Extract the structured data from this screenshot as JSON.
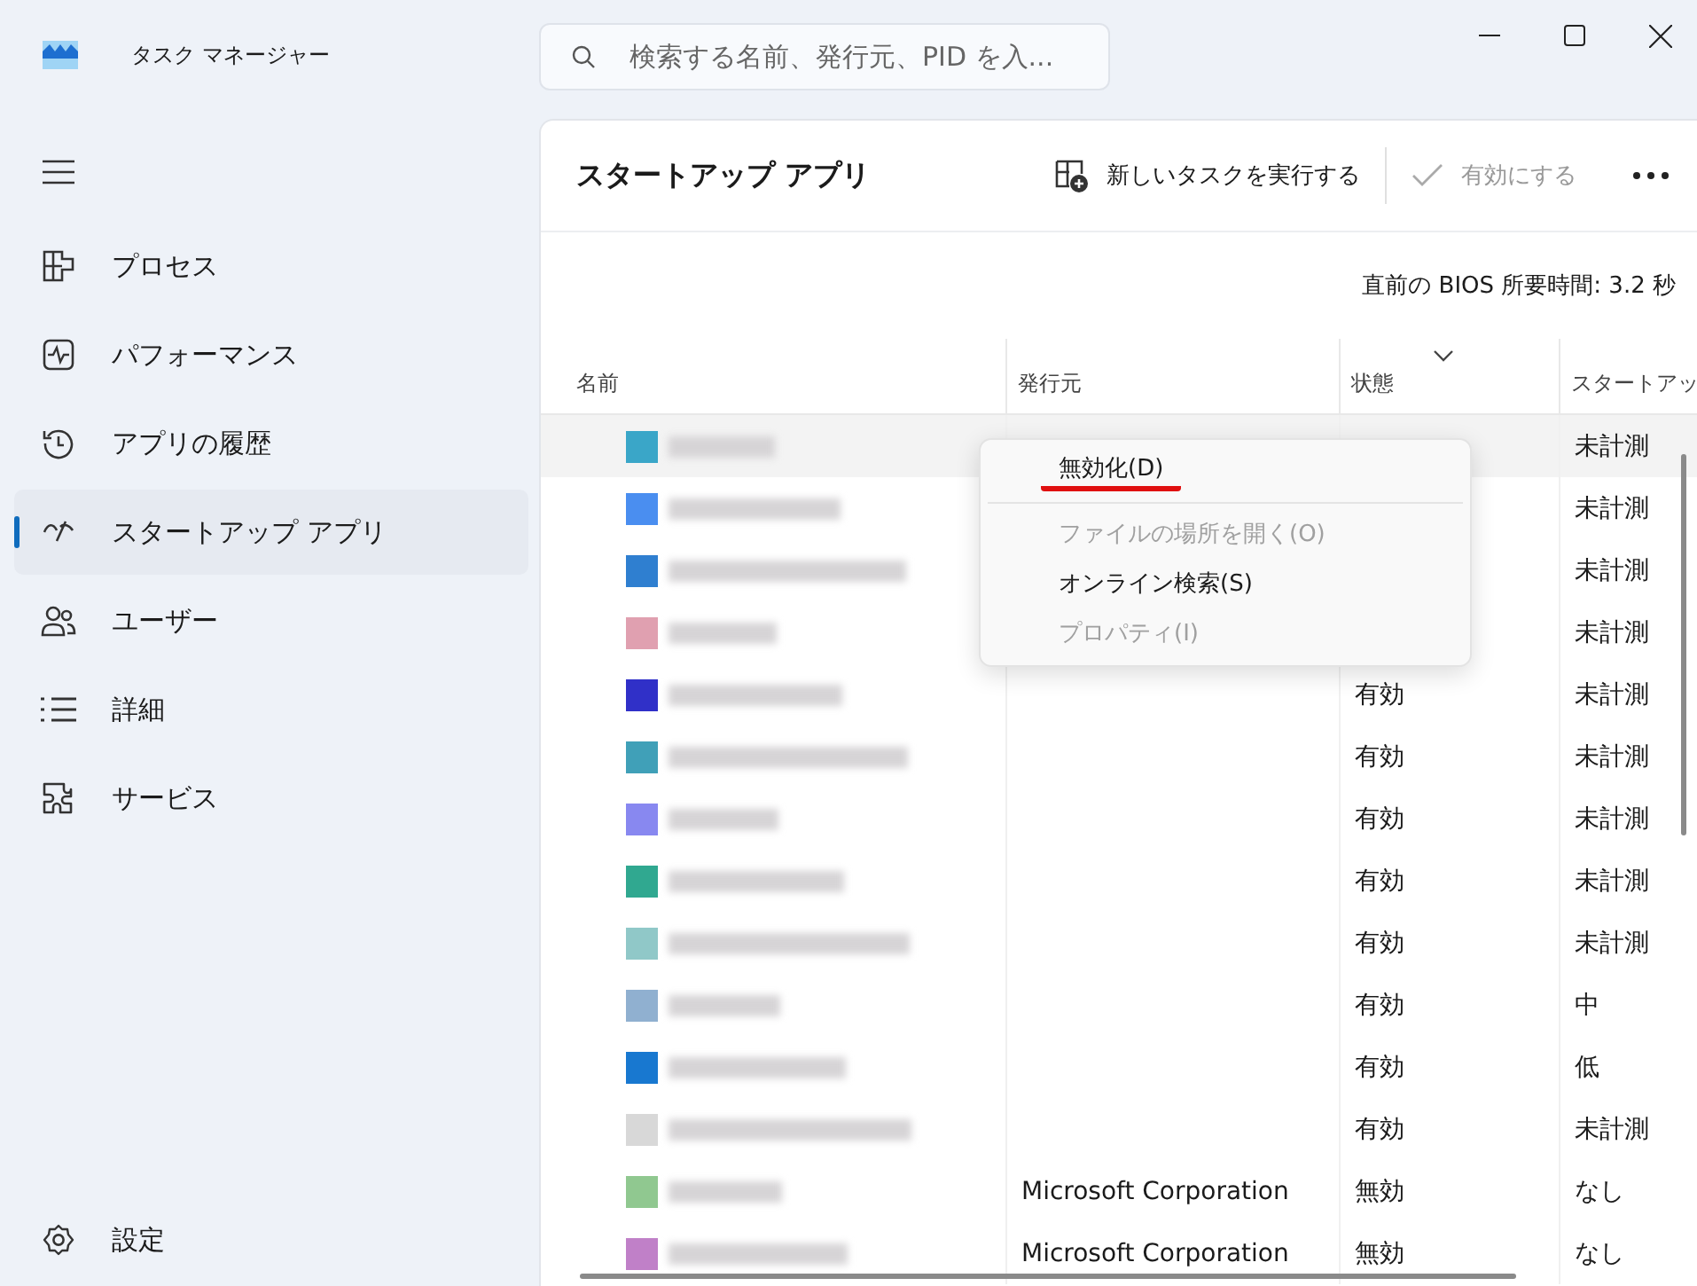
{
  "window": {
    "title": "タスク マネージャー"
  },
  "search": {
    "placeholder": "検索する名前、発行元、PID を入..."
  },
  "sidebar": {
    "items": [
      {
        "kind": "processes",
        "label": "プロセス",
        "selected": false
      },
      {
        "kind": "performance",
        "label": "パフォーマンス",
        "selected": false
      },
      {
        "kind": "history",
        "label": "アプリの履歴",
        "selected": false
      },
      {
        "kind": "startup",
        "label": "スタートアップ アプリ",
        "selected": true
      },
      {
        "kind": "users",
        "label": "ユーザー",
        "selected": false
      },
      {
        "kind": "details",
        "label": "詳細",
        "selected": false
      },
      {
        "kind": "services",
        "label": "サービス",
        "selected": false
      }
    ],
    "settings": "設定"
  },
  "header": {
    "title": "スタートアップ アプリ",
    "actions": [
      {
        "kind": "run",
        "label": "新しいタスクを実行する",
        "disabled": false
      },
      {
        "kind": "enable",
        "label": "有効にする",
        "disabled": true
      }
    ]
  },
  "bios_time": "直前の BIOS 所要時間: 3.2 秒",
  "table": {
    "columns": [
      {
        "label": "名前",
        "sorted": false
      },
      {
        "label": "発行元",
        "sorted": false
      },
      {
        "label": "状態",
        "sorted": true
      },
      {
        "label": "スタートアッ",
        "sorted": false
      }
    ],
    "rows": [
      {
        "publisher": "",
        "status": "",
        "impact": "未計測",
        "selected": true,
        "color": "#3aa6c8"
      },
      {
        "publisher": "",
        "status": "",
        "impact": "未計測",
        "selected": false,
        "color": "#4a8ef0"
      },
      {
        "publisher": "",
        "status": "",
        "impact": "未計測",
        "selected": false,
        "color": "#2f7fd0"
      },
      {
        "publisher": "",
        "status": "",
        "impact": "未計測",
        "selected": false,
        "color": "#e0a0b0"
      },
      {
        "publisher": "",
        "status": "有効",
        "impact": "未計測",
        "selected": false,
        "color": "#3030c8"
      },
      {
        "publisher": "",
        "status": "有効",
        "impact": "未計測",
        "selected": false,
        "color": "#40a0b8"
      },
      {
        "publisher": "",
        "status": "有効",
        "impact": "未計測",
        "selected": false,
        "color": "#8888f0"
      },
      {
        "publisher": "",
        "status": "有効",
        "impact": "未計測",
        "selected": false,
        "color": "#30a890"
      },
      {
        "publisher": "",
        "status": "有効",
        "impact": "未計測",
        "selected": false,
        "color": "#90c8c8"
      },
      {
        "publisher": "",
        "status": "有効",
        "impact": "中",
        "selected": false,
        "color": "#90b0d0"
      },
      {
        "publisher": "",
        "status": "有効",
        "impact": "低",
        "selected": false,
        "color": "#1878d0"
      },
      {
        "publisher": "",
        "status": "有効",
        "impact": "未計測",
        "selected": false,
        "color": "#d8d8d8"
      },
      {
        "publisher": "Microsoft Corporation",
        "status": "無効",
        "impact": "なし",
        "selected": false,
        "color": "#90c890"
      },
      {
        "publisher": "Microsoft Corporation",
        "status": "無効",
        "impact": "なし",
        "selected": false,
        "color": "#c080c8"
      }
    ]
  },
  "context_menu": {
    "items": [
      {
        "label": "無効化(D)",
        "disabled": false,
        "underlined": true
      },
      {
        "label": "ファイルの場所を開く(O)",
        "disabled": true,
        "underlined": false
      },
      {
        "label": "オンライン検索(S)",
        "disabled": false,
        "underlined": false
      },
      {
        "label": "プロパティ(I)",
        "disabled": true,
        "underlined": false
      }
    ]
  }
}
